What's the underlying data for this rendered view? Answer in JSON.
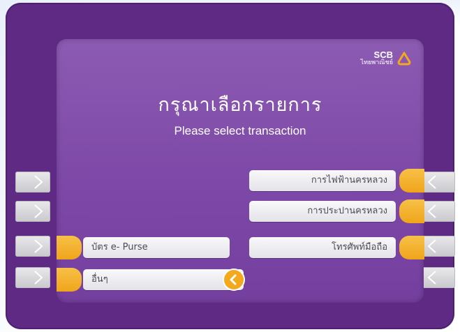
{
  "brand": {
    "name": "SCB",
    "name_thai": "ไทยพาณิชย์",
    "accent": "#f3a81e",
    "bezel_color": "#5e2a83",
    "screen_color": "#7d48a7"
  },
  "screen": {
    "title_thai": "กรุณาเลือกรายการ",
    "title_en": "Please select transaction"
  },
  "options_right": [
    {
      "label": "การไฟฟ้านครหลวง"
    },
    {
      "label": "การประปานครหลวง"
    },
    {
      "label": "โทรศัพท์มือถือ"
    }
  ],
  "options_left": [
    {
      "label": "บัตร e- Purse"
    },
    {
      "label": "อื่นๆ"
    }
  ],
  "icons": {
    "logo": "scb-logo-icon",
    "back": "back-arrow-icon",
    "side_key_right": "chevron-right-icon",
    "side_key_left": "chevron-left-icon"
  }
}
